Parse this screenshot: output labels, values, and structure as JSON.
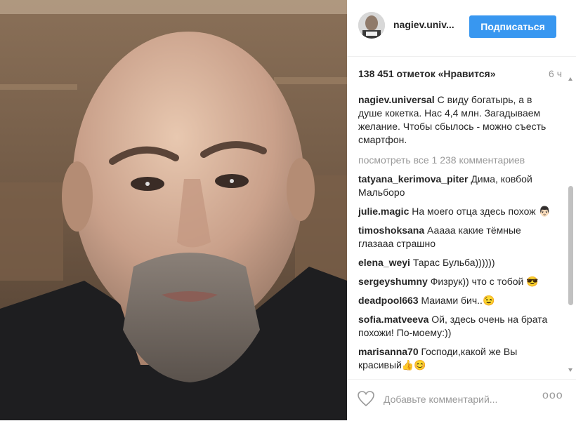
{
  "post": {
    "image_alt": "selfie photo"
  },
  "header": {
    "username": "nagiev.univ...",
    "follow_label": "Подписаться"
  },
  "likes": {
    "count_text": "138 451 отметок «Нравится»",
    "time": "6 ч"
  },
  "caption": {
    "author": "nagiev.universal",
    "text": "С виду богатырь, а в душе кокетка. Нас 4,4 млн. Загадываем желание. Чтобы сбылось - можно съесть смартфон."
  },
  "view_all_comments": "посмотреть все 1 238 комментариев",
  "comments": [
    {
      "author": "tatyana_kerimova_piter",
      "text": "Дима, ковбой Мальборо"
    },
    {
      "author": "julie.magic",
      "text": "На моего отца здесь похож 👨🏻"
    },
    {
      "author": "timoshoksana",
      "text": "Ааааа какие тёмные глазааа страшно"
    },
    {
      "author": "elena_weyi",
      "text": "Тарас Бульба))))))"
    },
    {
      "author": "sergeyshumny",
      "text": "Физрук)) что с тобой 😎"
    },
    {
      "author": "deadpool663",
      "text": "Маиами бич..😉"
    },
    {
      "author": "sofia.matveeva",
      "text": "Ой, здесь очень на брата похожи! По-моему:))"
    },
    {
      "author": "marisanna70",
      "text": "Господи,какой же Вы красивый👍😊"
    }
  ],
  "footer": {
    "comment_placeholder": "Добавьте комментарий...",
    "options_label": "ооо"
  },
  "colors": {
    "accent": "#3897f0",
    "muted_text": "#999999",
    "text": "#262626"
  },
  "icons": {
    "like": "heart-outline-icon",
    "options": "more-options-icon"
  }
}
